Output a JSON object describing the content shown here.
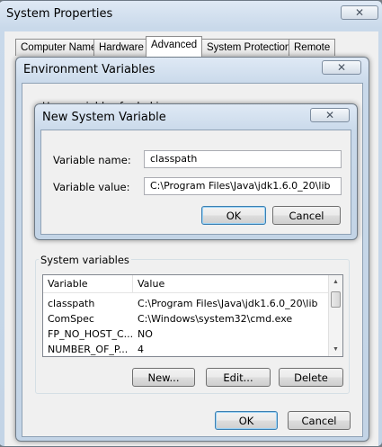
{
  "system_properties": {
    "title": "System Properties",
    "close_glyph": "✕",
    "tabs": [
      {
        "label": "Computer Name"
      },
      {
        "label": "Hardware"
      },
      {
        "label": "Advanced"
      },
      {
        "label": "System Protection"
      },
      {
        "label": "Remote"
      }
    ],
    "active_tab": "Advanced"
  },
  "environment_variables": {
    "title": "Environment Variables",
    "close_glyph": "✕",
    "user_vars_partial_label": "User variables for haki",
    "system_vars_label": "System variables",
    "columns": {
      "variable": "Variable",
      "value": "Value"
    },
    "rows": [
      {
        "variable": "classpath",
        "value": "C:\\Program Files\\Java\\jdk1.6.0_20\\lib"
      },
      {
        "variable": "ComSpec",
        "value": "C:\\Windows\\system32\\cmd.exe"
      },
      {
        "variable": "FP_NO_HOST_C...",
        "value": "NO"
      },
      {
        "variable": "NUMBER_OF_P...",
        "value": "4"
      }
    ],
    "buttons": {
      "new": "New...",
      "edit": "Edit...",
      "delete": "Delete"
    },
    "ok": "OK",
    "cancel": "Cancel"
  },
  "new_system_variable": {
    "title": "New System Variable",
    "close_glyph": "✕",
    "name_label": "Variable name:",
    "name_value": "classpath",
    "value_label": "Variable value:",
    "value_value": "C:\\Program Files\\Java\\jdk1.6.0_20\\lib",
    "ok": "OK",
    "cancel": "Cancel"
  }
}
